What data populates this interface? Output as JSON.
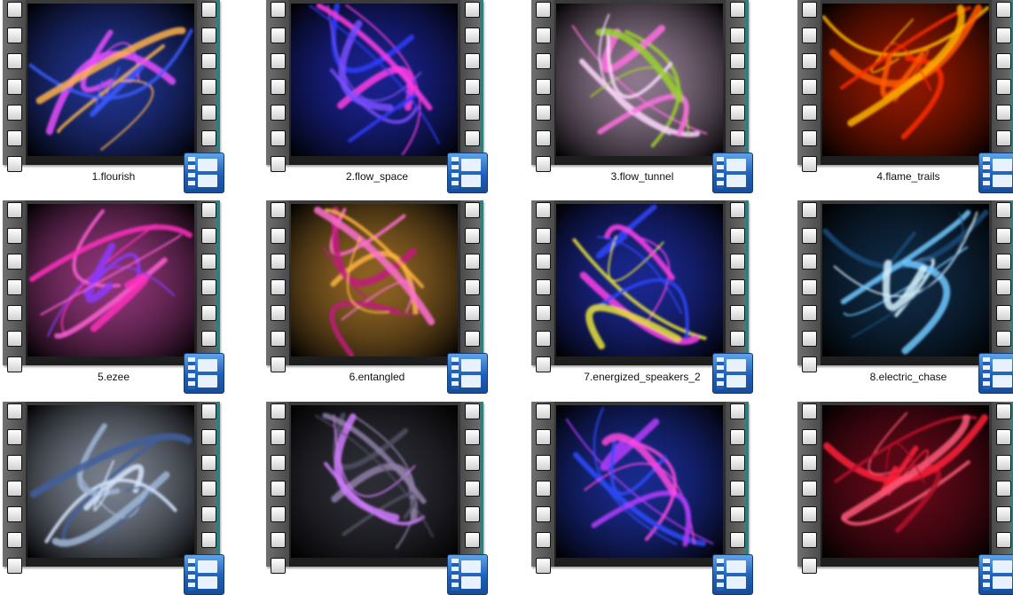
{
  "items": [
    {
      "label": "1.flourish",
      "colors": [
        "#e94cff",
        "#ffb24a",
        "#3a5bff"
      ]
    },
    {
      "label": "2.flow_space",
      "colors": [
        "#ff3ce8",
        "#7a4dff",
        "#2d3cff"
      ]
    },
    {
      "label": "3.flow_tunnel",
      "colors": [
        "#ff6fe0",
        "#9bd12d",
        "#ffd8ff"
      ]
    },
    {
      "label": "4.flame_trails",
      "colors": [
        "#ff5a00",
        "#ffb300",
        "#ff2a00"
      ]
    },
    {
      "label": "5.ezee",
      "colors": [
        "#ff2ebd",
        "#8c38ff",
        "#ff5fd5"
      ]
    },
    {
      "label": "6.entangled",
      "colors": [
        "#c21b7d",
        "#ff6ed0",
        "#ffb340"
      ]
    },
    {
      "label": "7.energized_speakers_2",
      "colors": [
        "#ff3ee8",
        "#e8e23a",
        "#2f46ff"
      ]
    },
    {
      "label": "8.electric_chase",
      "colors": [
        "#6fc8ff",
        "#d6f3ff",
        "#1b4a7a"
      ]
    },
    {
      "label": "",
      "colors": [
        "#9fb6d6",
        "#3f5f9f",
        "#d7e6ff"
      ]
    },
    {
      "label": "",
      "colors": [
        "#8f7fa8",
        "#d07bff",
        "#505060"
      ]
    },
    {
      "label": "",
      "colors": [
        "#b43cff",
        "#ff49e2",
        "#2d4bff"
      ]
    },
    {
      "label": "",
      "colors": [
        "#ff1f3a",
        "#ff5a7a",
        "#b0102a"
      ]
    }
  ]
}
